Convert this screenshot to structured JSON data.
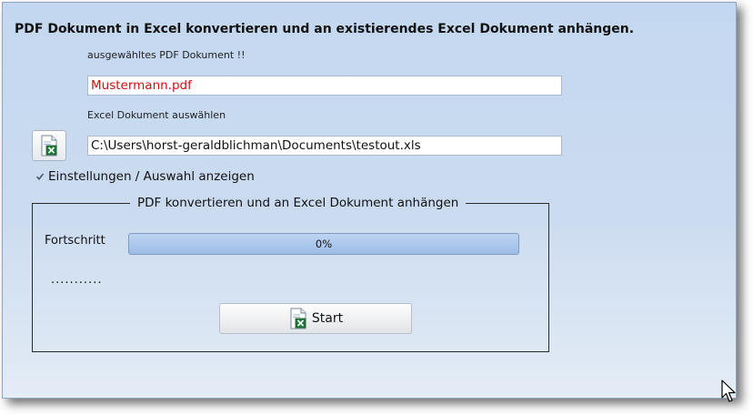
{
  "window": {
    "title": "PDF Dokument in Excel konvertieren und an existierendes Excel Dokument anhängen."
  },
  "pdf": {
    "label": "ausgewähltes PDF Dokument !!",
    "value": "Mustermann.pdf",
    "value_color": "#d01010"
  },
  "excel": {
    "label": "Excel Dokument auswählen",
    "path": "C:\\Users\\horst-geraldblichman\\Documents\\testout.xls",
    "button_icon": "excel-file-icon"
  },
  "options": {
    "show_settings_label": "Einstellungen / Auswahl  anzeigen",
    "show_settings_checked": true
  },
  "group": {
    "title": "PDF konvertieren und an Excel Dokument anhängen",
    "progress_label": "Fortschritt",
    "progress_percent": 0,
    "progress_text": "0%",
    "status_text": "...........",
    "start_label": "Start",
    "start_icon": "excel-file-icon"
  }
}
